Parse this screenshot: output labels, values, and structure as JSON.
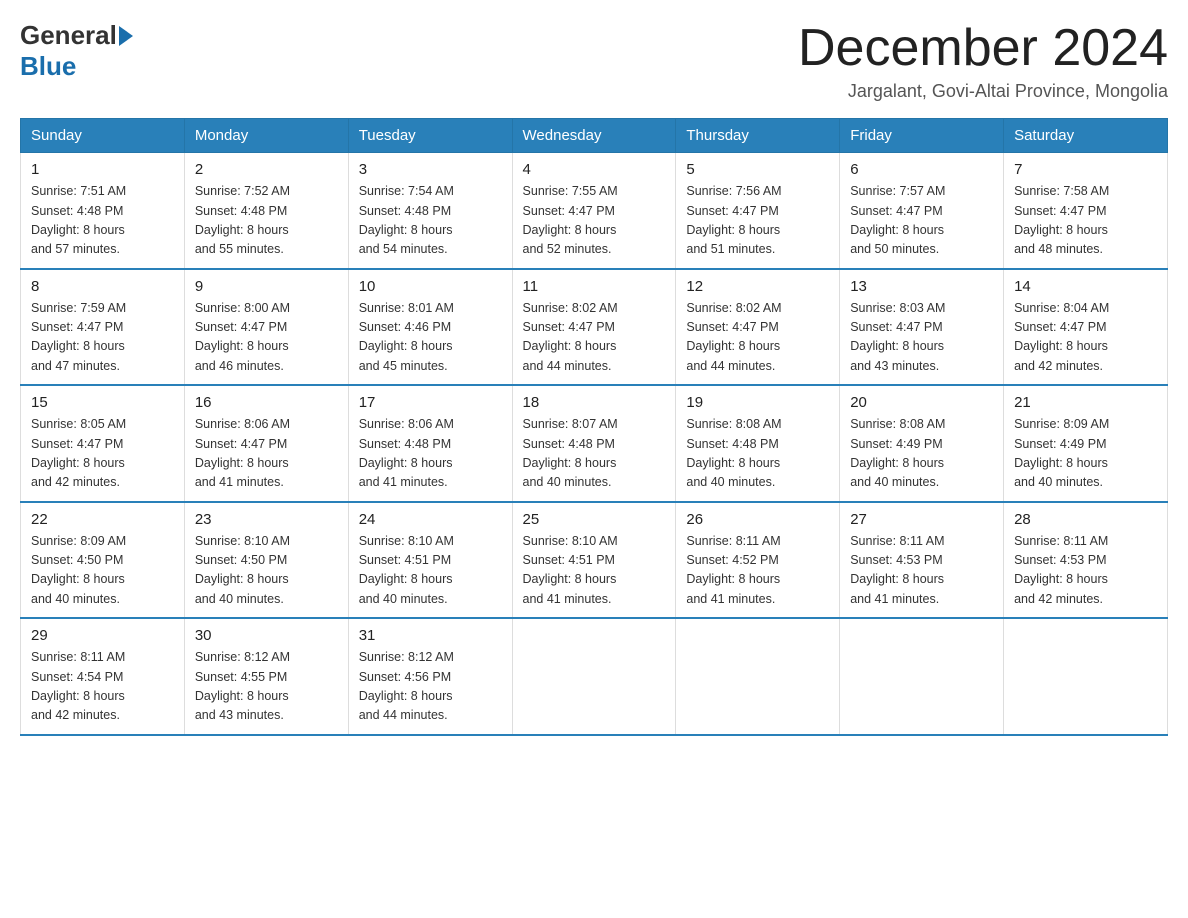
{
  "logo": {
    "general": "General",
    "blue": "Blue"
  },
  "title": "December 2024",
  "location": "Jargalant, Govi-Altai Province, Mongolia",
  "headers": [
    "Sunday",
    "Monday",
    "Tuesday",
    "Wednesday",
    "Thursday",
    "Friday",
    "Saturday"
  ],
  "weeks": [
    [
      {
        "day": "1",
        "sunrise": "7:51 AM",
        "sunset": "4:48 PM",
        "daylight": "8 hours and 57 minutes."
      },
      {
        "day": "2",
        "sunrise": "7:52 AM",
        "sunset": "4:48 PM",
        "daylight": "8 hours and 55 minutes."
      },
      {
        "day": "3",
        "sunrise": "7:54 AM",
        "sunset": "4:48 PM",
        "daylight": "8 hours and 54 minutes."
      },
      {
        "day": "4",
        "sunrise": "7:55 AM",
        "sunset": "4:47 PM",
        "daylight": "8 hours and 52 minutes."
      },
      {
        "day": "5",
        "sunrise": "7:56 AM",
        "sunset": "4:47 PM",
        "daylight": "8 hours and 51 minutes."
      },
      {
        "day": "6",
        "sunrise": "7:57 AM",
        "sunset": "4:47 PM",
        "daylight": "8 hours and 50 minutes."
      },
      {
        "day": "7",
        "sunrise": "7:58 AM",
        "sunset": "4:47 PM",
        "daylight": "8 hours and 48 minutes."
      }
    ],
    [
      {
        "day": "8",
        "sunrise": "7:59 AM",
        "sunset": "4:47 PM",
        "daylight": "8 hours and 47 minutes."
      },
      {
        "day": "9",
        "sunrise": "8:00 AM",
        "sunset": "4:47 PM",
        "daylight": "8 hours and 46 minutes."
      },
      {
        "day": "10",
        "sunrise": "8:01 AM",
        "sunset": "4:46 PM",
        "daylight": "8 hours and 45 minutes."
      },
      {
        "day": "11",
        "sunrise": "8:02 AM",
        "sunset": "4:47 PM",
        "daylight": "8 hours and 44 minutes."
      },
      {
        "day": "12",
        "sunrise": "8:02 AM",
        "sunset": "4:47 PM",
        "daylight": "8 hours and 44 minutes."
      },
      {
        "day": "13",
        "sunrise": "8:03 AM",
        "sunset": "4:47 PM",
        "daylight": "8 hours and 43 minutes."
      },
      {
        "day": "14",
        "sunrise": "8:04 AM",
        "sunset": "4:47 PM",
        "daylight": "8 hours and 42 minutes."
      }
    ],
    [
      {
        "day": "15",
        "sunrise": "8:05 AM",
        "sunset": "4:47 PM",
        "daylight": "8 hours and 42 minutes."
      },
      {
        "day": "16",
        "sunrise": "8:06 AM",
        "sunset": "4:47 PM",
        "daylight": "8 hours and 41 minutes."
      },
      {
        "day": "17",
        "sunrise": "8:06 AM",
        "sunset": "4:48 PM",
        "daylight": "8 hours and 41 minutes."
      },
      {
        "day": "18",
        "sunrise": "8:07 AM",
        "sunset": "4:48 PM",
        "daylight": "8 hours and 40 minutes."
      },
      {
        "day": "19",
        "sunrise": "8:08 AM",
        "sunset": "4:48 PM",
        "daylight": "8 hours and 40 minutes."
      },
      {
        "day": "20",
        "sunrise": "8:08 AM",
        "sunset": "4:49 PM",
        "daylight": "8 hours and 40 minutes."
      },
      {
        "day": "21",
        "sunrise": "8:09 AM",
        "sunset": "4:49 PM",
        "daylight": "8 hours and 40 minutes."
      }
    ],
    [
      {
        "day": "22",
        "sunrise": "8:09 AM",
        "sunset": "4:50 PM",
        "daylight": "8 hours and 40 minutes."
      },
      {
        "day": "23",
        "sunrise": "8:10 AM",
        "sunset": "4:50 PM",
        "daylight": "8 hours and 40 minutes."
      },
      {
        "day": "24",
        "sunrise": "8:10 AM",
        "sunset": "4:51 PM",
        "daylight": "8 hours and 40 minutes."
      },
      {
        "day": "25",
        "sunrise": "8:10 AM",
        "sunset": "4:51 PM",
        "daylight": "8 hours and 41 minutes."
      },
      {
        "day": "26",
        "sunrise": "8:11 AM",
        "sunset": "4:52 PM",
        "daylight": "8 hours and 41 minutes."
      },
      {
        "day": "27",
        "sunrise": "8:11 AM",
        "sunset": "4:53 PM",
        "daylight": "8 hours and 41 minutes."
      },
      {
        "day": "28",
        "sunrise": "8:11 AM",
        "sunset": "4:53 PM",
        "daylight": "8 hours and 42 minutes."
      }
    ],
    [
      {
        "day": "29",
        "sunrise": "8:11 AM",
        "sunset": "4:54 PM",
        "daylight": "8 hours and 42 minutes."
      },
      {
        "day": "30",
        "sunrise": "8:12 AM",
        "sunset": "4:55 PM",
        "daylight": "8 hours and 43 minutes."
      },
      {
        "day": "31",
        "sunrise": "8:12 AM",
        "sunset": "4:56 PM",
        "daylight": "8 hours and 44 minutes."
      },
      null,
      null,
      null,
      null
    ]
  ]
}
